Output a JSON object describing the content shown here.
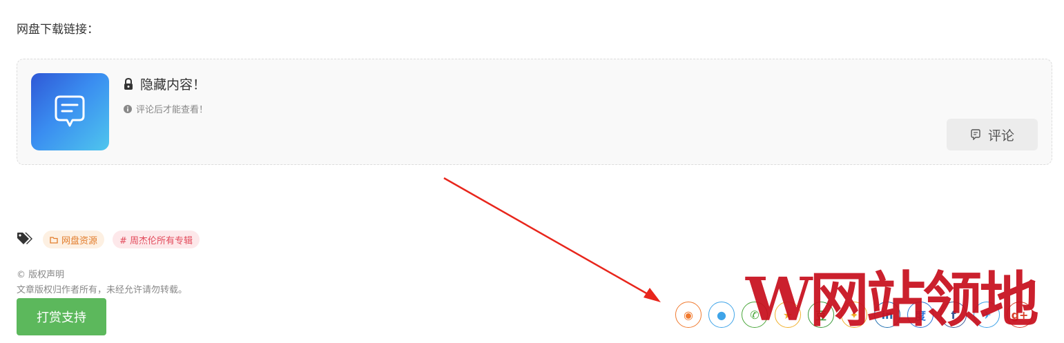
{
  "heading": "网盘下载链接：",
  "hidden_box": {
    "title": "隐藏内容！",
    "subtitle": "评论后才能查看！",
    "comment_button": "评论"
  },
  "tags": [
    {
      "label": "网盘资源",
      "kind": "category"
    },
    {
      "label": "# 周杰伦所有专辑",
      "kind": "hashtag"
    }
  ],
  "copyright": {
    "title": "© 版权声明",
    "text": "文章版权归作者所有，未经允许请勿转载。"
  },
  "reward_button": "打赏支持",
  "share_icons": [
    {
      "name": "weibo",
      "glyph": "◉",
      "color": "#f07a2f"
    },
    {
      "name": "qq",
      "glyph": "●",
      "color": "#3fa4e8"
    },
    {
      "name": "wechat",
      "glyph": "✆",
      "color": "#49a63a"
    },
    {
      "name": "qzone",
      "glyph": "★",
      "color": "#f0b02a"
    },
    {
      "name": "douban",
      "glyph": "豆",
      "color": "#3a9a3a"
    },
    {
      "name": "qq-zone-star",
      "glyph": "✦",
      "color": "#f0b02a"
    },
    {
      "name": "linkedin",
      "glyph": "in",
      "color": "#1f6fb0"
    },
    {
      "name": "baidu",
      "glyph": "度",
      "color": "#2a72d6"
    },
    {
      "name": "facebook",
      "glyph": "f",
      "color": "#3b5998"
    },
    {
      "name": "twitter",
      "glyph": "✈",
      "color": "#3aa0e8"
    },
    {
      "name": "google-plus",
      "glyph": "g+",
      "color": "#d8402c"
    }
  ],
  "watermark": "W网站领地",
  "colors": {
    "accent_green": "#5cb85c",
    "arrow_red": "#e8261c"
  }
}
